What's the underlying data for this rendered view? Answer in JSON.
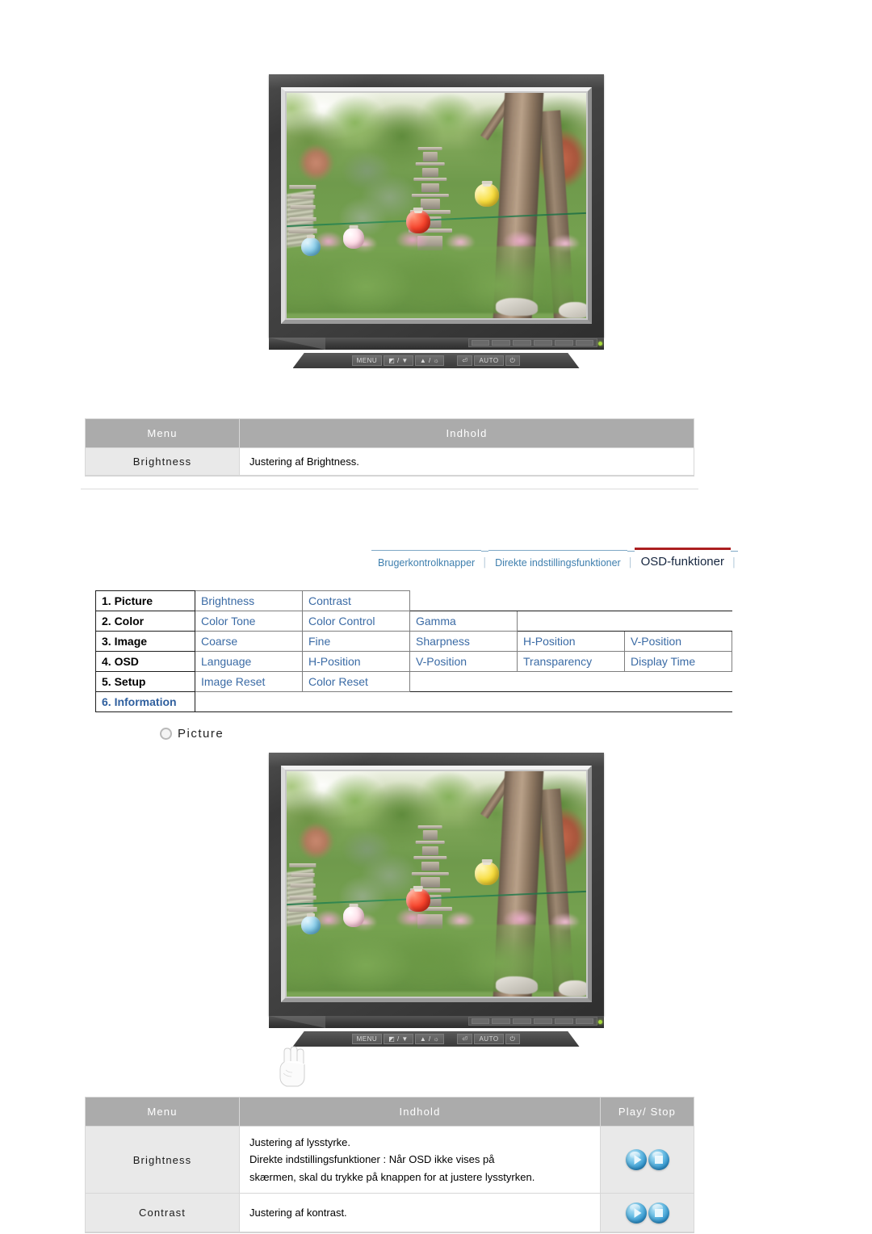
{
  "monitor_top": {
    "buttons": [
      {
        "name": "menu-button",
        "label": "MENU"
      },
      {
        "name": "contrast-down-button",
        "label": "◩ / ▼"
      },
      {
        "name": "up-brightness-button",
        "label": "▲ / ☼"
      },
      {
        "name": "enter-button",
        "label": "⏎"
      },
      {
        "name": "auto-button",
        "label": "AUTO"
      },
      {
        "name": "power-button",
        "label": "⏻"
      }
    ],
    "screen_alt": "Temple garden photo with stone pagoda and colored paper lanterns"
  },
  "table_top": {
    "headers": [
      "Menu",
      "Indhold"
    ],
    "rows": [
      {
        "menu": "Brightness",
        "indhold": "Justering af Brightness."
      }
    ]
  },
  "navbar": {
    "items": [
      {
        "label": "Brugerkontrolknapper",
        "active": false
      },
      {
        "label": "Direkte indstillingsfunktioner",
        "active": false
      },
      {
        "label": "OSD-funktioner",
        "active": true
      }
    ],
    "separator": "│",
    "active_color": "#ab1f20",
    "link_color": "#3f7fae"
  },
  "osd_structure": {
    "rows": [
      {
        "label": "1. Picture",
        "items": [
          "Brightness",
          "Contrast"
        ]
      },
      {
        "label": "2. Color",
        "items": [
          "Color Tone",
          "Color Control",
          "Gamma"
        ]
      },
      {
        "label": "3. Image",
        "items": [
          "Coarse",
          "Fine",
          "Sharpness",
          "H-Position",
          "V-Position"
        ]
      },
      {
        "label": "4. OSD",
        "items": [
          "Language",
          "H-Position",
          "V-Position",
          "Transparency",
          "Display Time"
        ]
      },
      {
        "label": "5. Setup",
        "items": [
          "Image Reset",
          "Color Reset"
        ]
      },
      {
        "label": "6. Information",
        "items": []
      }
    ]
  },
  "section": {
    "title": "Picture"
  },
  "table_bottom": {
    "headers": [
      "Menu",
      "Indhold",
      "Play/ Stop"
    ],
    "rows": [
      {
        "menu": "Brightness",
        "lines": [
          "Justering af lysstyrke.",
          "Direkte indstillingsfunktioner : Når OSD ikke vises på",
          "skærmen, skal du trykke på knappen for at justere lysstyrken."
        ],
        "play": "play-icon",
        "stop": "stop-icon"
      },
      {
        "menu": "Contrast",
        "lines": [
          "Justering af kontrast."
        ],
        "play": "play-icon",
        "stop": "stop-icon"
      }
    ]
  }
}
